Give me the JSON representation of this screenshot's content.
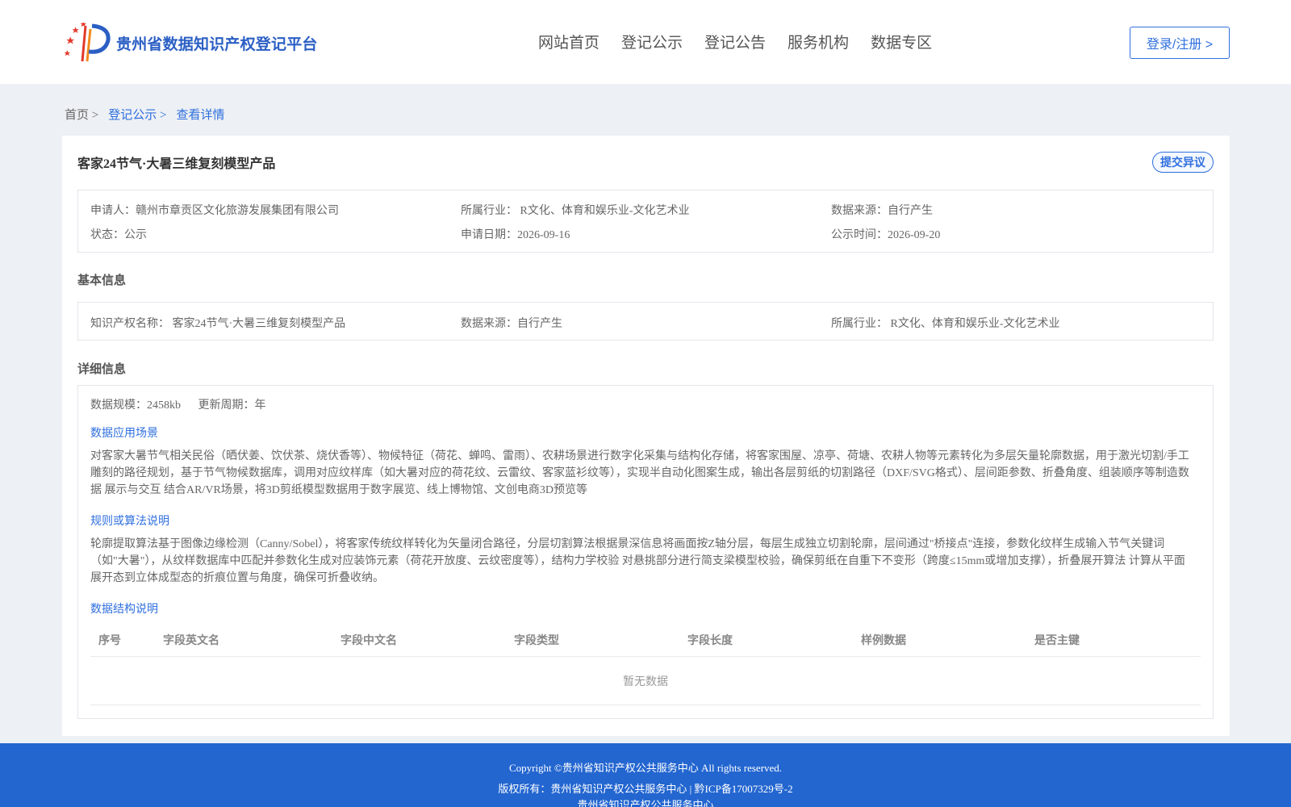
{
  "header": {
    "site_name": "贵州省数据知识产权登记平台",
    "nav": [
      "网站首页",
      "登记公示",
      "登记公告",
      "服务机构",
      "数据专区"
    ],
    "login_label": "登录/注册 >"
  },
  "breadcrumb": [
    "首页 >",
    "登记公示 >",
    "查看详情"
  ],
  "record": {
    "title": "客家24节气·大暑三维复刻模型产品",
    "objection_label": "提交异议",
    "applicant": "申请人：赣州市章贡区文化旅游发展集团有限公司",
    "industry": "所属行业： R文化、体育和娱乐业-文化艺术业",
    "source": "数据来源：自行产生",
    "status": "状态：公示",
    "apply_date": "申请日期：2026-09-16",
    "publish_date": "公示时间：2026-09-20"
  },
  "basic": {
    "label": "基本信息",
    "ip_name": "知识产权名称： 客家24节气·大暑三维复刻模型产品",
    "source": "数据来源：自行产生",
    "industry": "所属行业： R文化、体育和娱乐业-文化艺术业"
  },
  "detail": {
    "label": "详细信息",
    "scale": "数据规模：2458kb",
    "cycle": "更新周期：年",
    "scenario_label": "数据应用场景",
    "scenario_text": "对客家大暑节气相关民俗（晒伏姜、饮伏茶、烧伏香等）、物候特征（荷花、蝉鸣、雷雨）、农耕场景进行数字化采集与结构化存储，将客家围屋、凉亭、荷塘、农耕人物等元素转化为多层矢量轮廓数据，用于激光切割/手工雕刻的路径规划，基于节气物候数据库，调用对应纹样库（如大暑对应的荷花纹、云雷纹、客家蓝衫纹等），实现半自动化图案生成，输出各层剪纸的切割路径（DXF/SVG格式）、层间距参数、折叠角度、组装顺序等制造数据 展示与交互 结合AR/VR场景，将3D剪纸模型数据用于数字展览、线上博物馆、文创电商3D预览等",
    "algo_label": "规则或算法说明",
    "algo_text": "轮廓提取算法基于图像边缘检测（Canny/Sobel），将客家传统纹样转化为矢量闭合路径，分层切割算法根据景深信息将画面按Z轴分层，每层生成独立切割轮廓，层间通过\"桥接点\"连接，参数化纹样生成输入节气关键词（如\"大暑\"），从纹样数据库中匹配并参数化生成对应装饰元素（荷花开放度、云纹密度等），结构力学校验 对悬挑部分进行简支梁模型校验，确保剪纸在自重下不变形（跨度≤15mm或增加支撑），折叠展开算法 计算从平面展开态到立体成型态的折痕位置与角度，确保可折叠收纳。",
    "structure_label": "数据结构说明",
    "columns": [
      "序号",
      "字段英文名",
      "字段中文名",
      "字段类型",
      "字段长度",
      "样例数据",
      "是否主键"
    ],
    "empty_text": "暂无数据"
  },
  "footer": {
    "line1": "Copyright ©贵州省知识产权公共服务中心 All rights reserved.",
    "line2": "版权所有：贵州省知识产权公共服务中心 | 黔ICP备17007329号-2",
    "line3": "贵州省知识产权公共服务中心"
  },
  "colors": {
    "brand": "#2b5fc4",
    "accent": "#2f6fde",
    "footer": "#2366d0"
  }
}
